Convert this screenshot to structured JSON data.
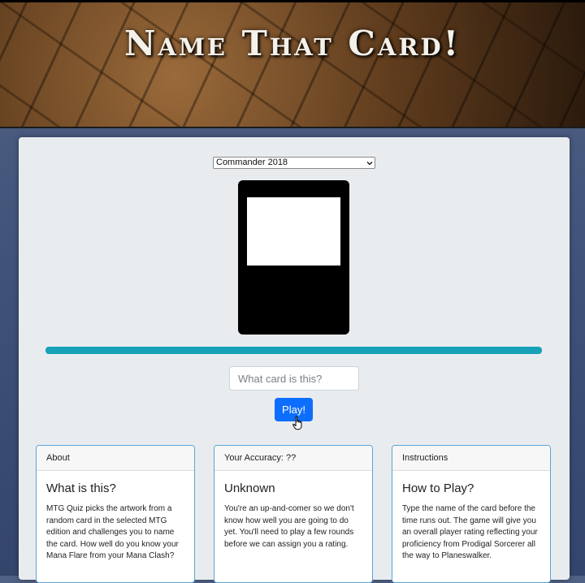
{
  "header": {
    "title": "Name That Card!"
  },
  "game": {
    "edition_select": {
      "selected": "Commander 2018"
    },
    "answer_input": {
      "placeholder": "What card is this?",
      "value": ""
    },
    "play_button_label": "Play!",
    "timer_progress": 1.0
  },
  "info_cards": [
    {
      "header": "About",
      "title": "What is this?",
      "text": "MTG Quiz picks the artwork from a random card in the selected MTG edition and challenges you to name the card. How well do you know your Mana Flare from your Mana Clash?"
    },
    {
      "header": "Your Accuracy: ??",
      "title": "Unknown",
      "text": "You're an up-and-comer so we don't know how well you are going to do yet. You'll need to play a few rounds before we can assign you a rating."
    },
    {
      "header": "Instructions",
      "title": "How to Play?",
      "text": "Type the name of the card before the time runs out. The game will give you an overall player rating reflecting your proficiency from Prodigal Sorcerer all the way to Planeswalker."
    }
  ],
  "colors": {
    "timer": "#17a2b8",
    "play_button": "#0d6efd",
    "card_border": "#5aa5d6",
    "background": "#3f5177"
  },
  "icons": {
    "select_arrow": "chevron-down-icon",
    "cursor": "hand-pointer-icon"
  }
}
